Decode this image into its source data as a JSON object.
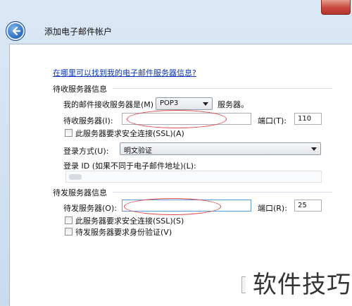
{
  "window": {
    "title": "添加电子邮件帐户"
  },
  "help_link": "在哪里可以找到我的电子邮件服务器信息?",
  "incoming": {
    "section_title": "待收服务器信息",
    "server_type_label": "我的邮件接收服务器是(M)",
    "server_type_value": "POP3",
    "server_type_suffix": "服务器。",
    "server_label": "待收服务器(I):",
    "server_value": "",
    "port_label": "端口(T):",
    "port_value": "110",
    "ssl_label": "此服务器要求安全连接(SSL)(A)",
    "login_method_label": "登录方式(U):",
    "login_method_value": "明文验证",
    "login_id_label": "登录 ID (如果不同于电子邮件地址)(L):",
    "login_id_value": ""
  },
  "outgoing": {
    "section_title": "待发服务器信息",
    "server_label": "待发服务器(O):",
    "server_value": "",
    "port_label": "端口(R):",
    "port_value": "25",
    "ssl_label": "此服务器要求安全连接(SSL)(S)",
    "auth_label": "待发服务器要求身份验证(V)"
  },
  "watermark": "软件技巧",
  "colors": {
    "link": "#0b35b8",
    "annotation_ellipse": "#e0474c"
  }
}
